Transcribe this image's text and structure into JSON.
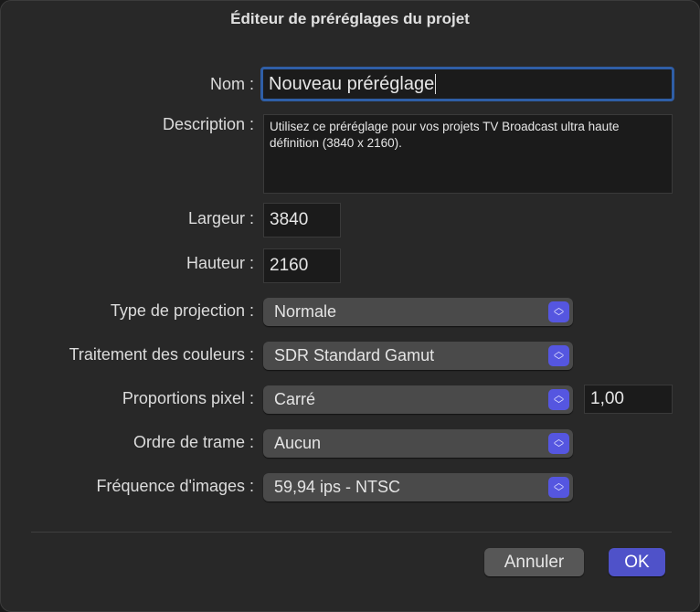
{
  "title": "Éditeur de préréglages du projet",
  "fields": {
    "name": {
      "label": "Nom :",
      "value": "Nouveau préréglage"
    },
    "description": {
      "label": "Description :",
      "value": "Utilisez ce préréglage pour vos projets TV Broadcast ultra haute définition (3840 x 2160)."
    },
    "width": {
      "label": "Largeur :",
      "value": "3840"
    },
    "height": {
      "label": "Hauteur :",
      "value": "2160"
    },
    "projection": {
      "label": "Type de projection :",
      "value": "Normale"
    },
    "color": {
      "label": "Traitement des couleurs :",
      "value": "SDR Standard Gamut"
    },
    "pixel": {
      "label": "Proportions pixel :",
      "value": "Carré",
      "ratio": "1,00"
    },
    "field_order": {
      "label": "Ordre de trame :",
      "value": "Aucun"
    },
    "frame_rate": {
      "label": "Fréquence d'images :",
      "value": "59,94 ips - NTSC"
    }
  },
  "buttons": {
    "cancel": "Annuler",
    "ok": "OK"
  },
  "colors": {
    "accent": "#5556e0",
    "focus": "#2f5ea6",
    "ok": "#4f52c9"
  }
}
